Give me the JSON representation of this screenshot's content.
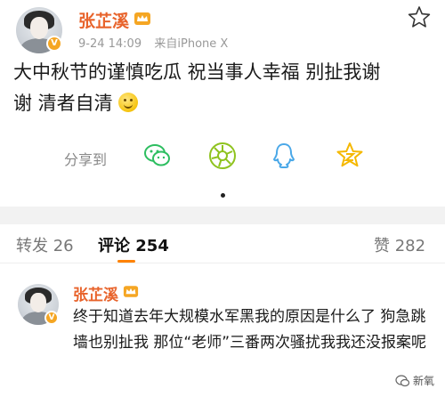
{
  "post": {
    "author": "张芷溪",
    "time": "9-24 14:09",
    "source": "来自iPhone X",
    "text_line1": "大中秋节的谨慎吃瓜 祝当事人幸福 别扯我谢",
    "text_line2": "谢 清者自清",
    "share_label": "分享到",
    "share_targets": [
      "wechat-icon",
      "moments-icon",
      "qq-icon",
      "qzone-icon"
    ]
  },
  "tabs": {
    "repost": "转发 26",
    "comments": "评论 254",
    "likes": "赞 282"
  },
  "comment": {
    "author": "张芷溪",
    "text": "终于知道去年大规模水军黑我的原因是什么了 狗急跳墙也别扯我 那位“老师”三番两次骚扰我我还没报案呢"
  },
  "watermark": {
    "label": "新氧"
  },
  "colors": {
    "name": "#e8632b",
    "accent": "#ff8200",
    "badge": "#f5a623",
    "wechat": "#2dbe60",
    "moments": "#8fc31f",
    "qq": "#4aa8e8",
    "qzone": "#f5b800"
  }
}
